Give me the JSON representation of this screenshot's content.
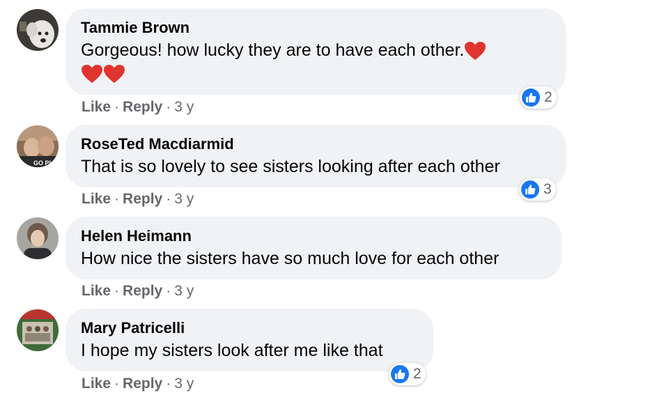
{
  "comments": [
    {
      "author": "Tammie Brown",
      "text": "Gorgeous! how lucky they are to have each other.",
      "like_label": "Like",
      "reply_label": "Reply",
      "time": "3 y",
      "reaction_count": "2",
      "avatar_icon": "dog-avatar"
    },
    {
      "author": "RoseTed Macdiarmid",
      "text": "That is so lovely to see sisters looking after each other",
      "like_label": "Like",
      "reply_label": "Reply",
      "time": "3 y",
      "reaction_count": "3",
      "avatar_icon": "couple-avatar"
    },
    {
      "author": "Helen Heimann",
      "text": "How nice the sisters have so much love for each other",
      "like_label": "Like",
      "reply_label": "Reply",
      "time": "3 y",
      "reaction_count": "",
      "avatar_icon": "woman-avatar"
    },
    {
      "author": "Mary Patricelli",
      "text": "I hope my sisters look after me like that",
      "like_label": "Like",
      "reply_label": "Reply",
      "time": "3 y",
      "reaction_count": "2",
      "avatar_icon": "group-photo-avatar"
    }
  ],
  "separator": "·",
  "colors": {
    "bubble": "#f0f2f5",
    "like_blue": "#1877f2",
    "meta_gray": "#65676b",
    "heart_red": "#e0342f"
  }
}
